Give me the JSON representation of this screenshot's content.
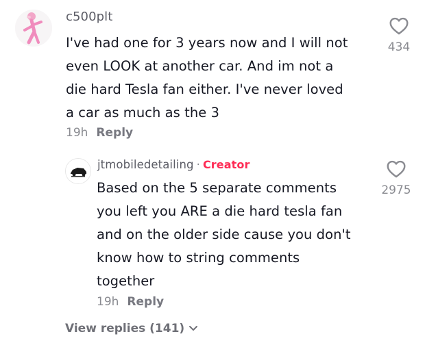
{
  "comment": {
    "username": "c500plt",
    "text_lines": [
      "I've had one for 3 years now and I will not",
      "even LOOK at another car. And im not a",
      "die hard Tesla fan either. I've never loved",
      "a car as much as the 3"
    ],
    "time": "19h",
    "reply_label": "Reply",
    "likes": "434"
  },
  "reply": {
    "username": "jtmobiledetailing",
    "separator": "·",
    "badge": "Creator",
    "text_lines": [
      "Based on the 5 separate comments",
      "you left you ARE a die hard tesla fan",
      "and on the older side cause you don't",
      "know how to string comments",
      "together"
    ],
    "time": "19h",
    "reply_label": "Reply",
    "likes": "2975"
  },
  "view_replies": {
    "label": "View replies (141)"
  },
  "colors": {
    "creator_badge": "#fe2c55",
    "muted_text": "#8a8b91"
  },
  "icons": [
    "heart-outline-icon",
    "chevron-down-icon"
  ]
}
